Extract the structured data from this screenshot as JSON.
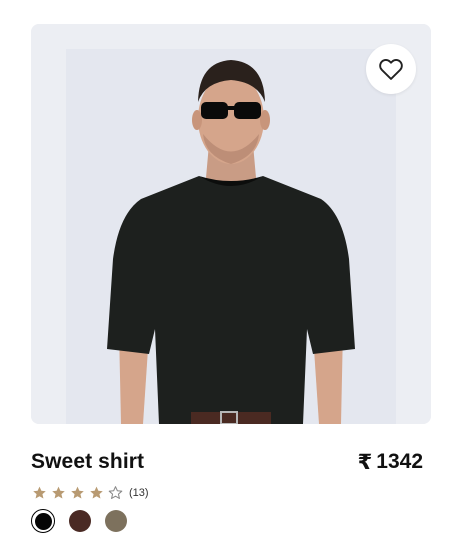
{
  "product": {
    "name": "Sweet shirt",
    "currency_symbol": "₹",
    "price": "1342",
    "image_alt": "",
    "wishlist_icon": "heart-outline-icon"
  },
  "rating": {
    "value": 4,
    "max": 5,
    "count_label": "(13)",
    "filled_color": "#b89a72",
    "empty_color": "#8a8a8a"
  },
  "swatches": [
    {
      "name": "black",
      "color": "#050505",
      "selected": true
    },
    {
      "name": "brown",
      "color": "#4a2a24",
      "selected": false
    },
    {
      "name": "olive",
      "color": "#7d715d",
      "selected": false
    }
  ]
}
